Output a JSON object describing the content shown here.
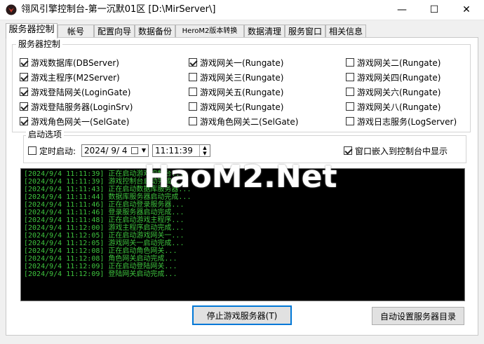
{
  "window": {
    "title": "翎风引擎控制台-第一沉默01区 [D:\\MirServer\\]",
    "minimize": "—",
    "maximize": "☐",
    "close": "✕"
  },
  "tabs": [
    {
      "label": "服务器控制"
    },
    {
      "label": "帐号"
    },
    {
      "label": "配置向导"
    },
    {
      "label": "数据备份"
    },
    {
      "label": "HeroM2版本转换"
    },
    {
      "label": "数据清理"
    },
    {
      "label": "服务窗口"
    },
    {
      "label": "相关信息"
    }
  ],
  "server_control": {
    "legend": "服务器控制",
    "checkboxes": [
      {
        "label": "游戏数据库(DBServer)",
        "checked": true
      },
      {
        "label": "游戏主程序(M2Server)",
        "checked": true
      },
      {
        "label": "游戏登陆网关(LoginGate)",
        "checked": true
      },
      {
        "label": "游戏登陆服务器(LoginSrv)",
        "checked": true
      },
      {
        "label": "游戏角色网关一(SelGate)",
        "checked": true
      },
      {
        "label": "游戏网关一(Rungate)",
        "checked": true
      },
      {
        "label": "游戏网关三(Rungate)",
        "checked": false
      },
      {
        "label": "游戏网关五(Rungate)",
        "checked": false
      },
      {
        "label": "游戏网关七(Rungate)",
        "checked": false
      },
      {
        "label": "游戏角色网关二(SelGate)",
        "checked": false
      },
      {
        "label": "游戏网关二(Rungate)",
        "checked": false
      },
      {
        "label": "游戏网关四(Rungate)",
        "checked": false
      },
      {
        "label": "游戏网关六(Rungate)",
        "checked": false
      },
      {
        "label": "游戏网关八(Rungate)",
        "checked": false
      },
      {
        "label": "游戏日志服务(LogServer)",
        "checked": false
      }
    ]
  },
  "startup": {
    "legend": "启动选项",
    "timed_start": {
      "label": "定时启动:",
      "checked": false
    },
    "date": "2024/ 9/ 4",
    "time": "11:11:39",
    "embed": {
      "label": "窗口嵌入到控制台中显示",
      "checked": true
    }
  },
  "log": [
    "[2024/9/4 11:11:39] 正在启动游戏控制台...",
    "[2024/9/4 11:11:39] 游戏控制台启动完成...",
    "[2024/9/4 11:11:43] 正在启动数据库服务器...",
    "[2024/9/4 11:11:44] 数据库服务器启动完成...",
    "[2024/9/4 11:11:46] 正在启动登录服务器...",
    "[2024/9/4 11:11:46] 登录服务器启动完成...",
    "[2024/9/4 11:11:48] 正在启动游戏主程序...",
    "[2024/9/4 11:12:00] 游戏主程序启动完成...",
    "[2024/9/4 11:12:05] 正在启动游戏网关一...",
    "[2024/9/4 11:12:05] 游戏网关一启动完成...",
    "[2024/9/4 11:12:08] 正在启动角色网关...",
    "[2024/9/4 11:12:08] 角色网关启动完成...",
    "[2024/9/4 11:12:09] 正在启动登陆网关...",
    "[2024/9/4 11:12:09] 登陆网关启动完成..."
  ],
  "watermark": "HaoM2.Net",
  "buttons": {
    "stop": "停止游戏服务器(T)",
    "auto_dir": "自动设置服务器目录"
  },
  "colors": {
    "log_text": "#3ec43e",
    "log_bg": "#000000",
    "accent": "#0078d7"
  }
}
